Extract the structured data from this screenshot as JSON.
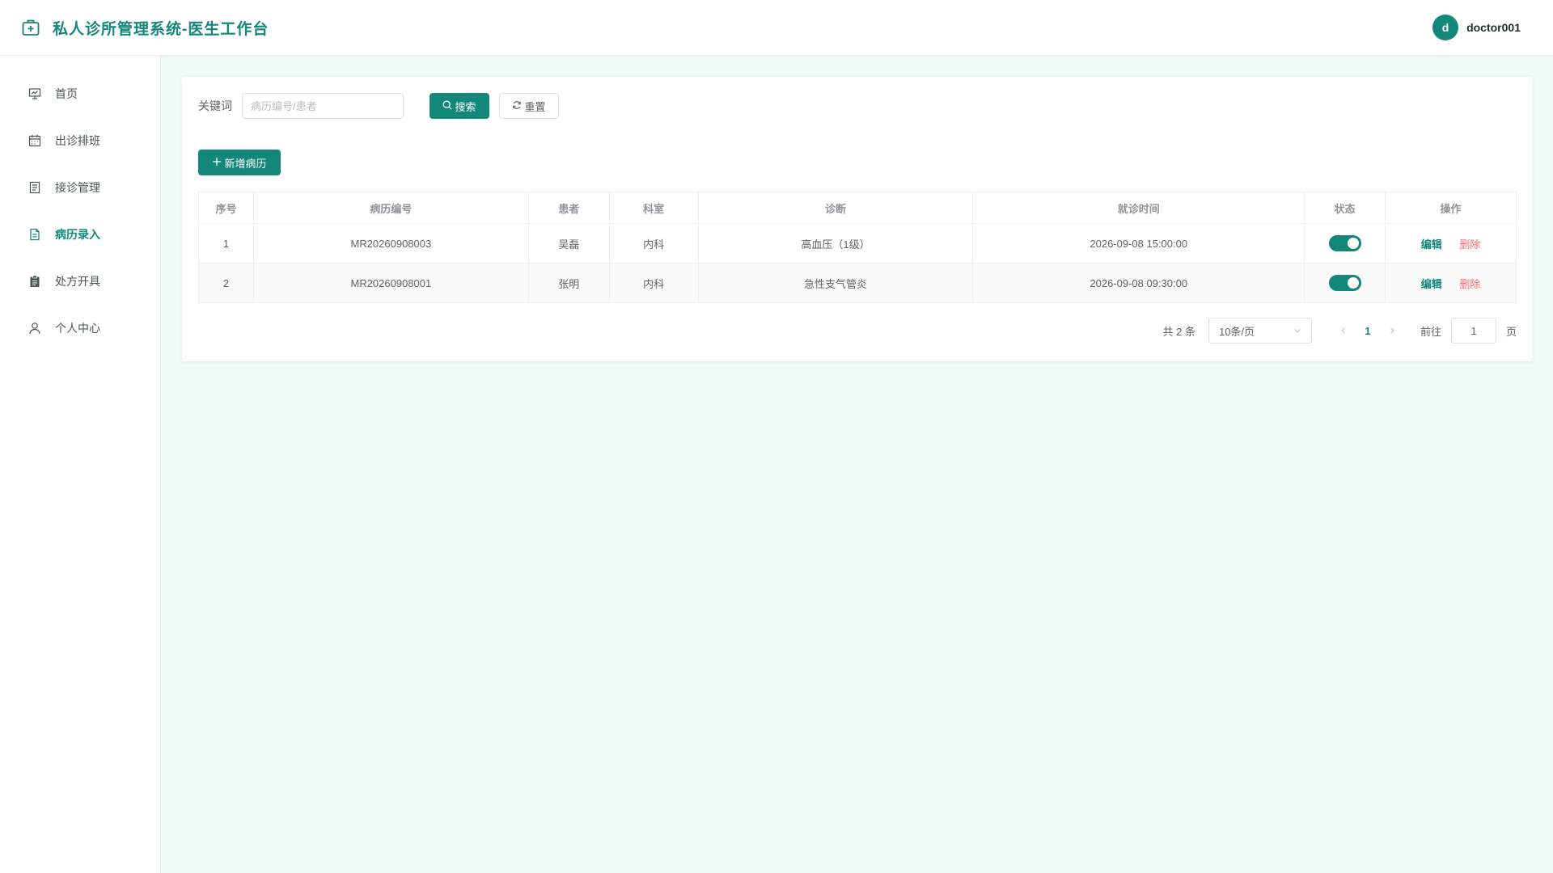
{
  "header": {
    "title": "私人诊所管理系统-医生工作台",
    "user": {
      "avatar_letter": "d",
      "name": "doctor001"
    }
  },
  "sidebar": {
    "items": [
      {
        "label": "首页",
        "icon": "presentation-board-icon",
        "active": false
      },
      {
        "label": "出诊排班",
        "icon": "calendar-icon",
        "active": false
      },
      {
        "label": "接诊管理",
        "icon": "document-list-icon",
        "active": false
      },
      {
        "label": "病历录入",
        "icon": "document-icon",
        "active": true
      },
      {
        "label": "处方开具",
        "icon": "clipboard-icon",
        "active": false
      },
      {
        "label": "个人中心",
        "icon": "user-icon",
        "active": false
      }
    ]
  },
  "search": {
    "label": "关键词",
    "placeholder": "病历编号/患者",
    "value": "",
    "search_button": "搜索",
    "reset_button": "重置"
  },
  "actions": {
    "add_button": "新增病历"
  },
  "table": {
    "headers": [
      "序号",
      "病历编号",
      "患者",
      "科室",
      "诊断",
      "就诊时间",
      "状态",
      "操作"
    ],
    "rows": [
      {
        "index": "1",
        "record_no": "MR20260908003",
        "patient": "吴磊",
        "dept": "内科",
        "diagnosis": "高血压（1级）",
        "visit_time": "2026-09-08 15:00:00",
        "status_on": true,
        "edit": "编辑",
        "delete": "删除"
      },
      {
        "index": "2",
        "record_no": "MR20260908001",
        "patient": "张明",
        "dept": "内科",
        "diagnosis": "急性支气管炎",
        "visit_time": "2026-09-08 09:30:00",
        "status_on": true,
        "edit": "编辑",
        "delete": "删除"
      }
    ]
  },
  "pagination": {
    "total_text": "共 2 条",
    "page_size": "10条/页",
    "current_page": "1",
    "goto_label": "前往",
    "goto_value": "1",
    "goto_suffix": "页"
  },
  "colors": {
    "accent": "#13877a",
    "danger": "#f56c6c",
    "background": "#f0fbf8"
  }
}
